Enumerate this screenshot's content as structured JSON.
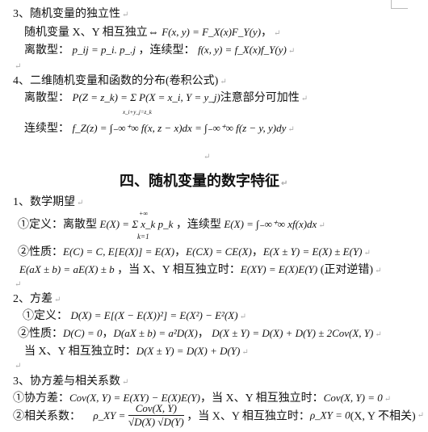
{
  "sec3": {
    "heading": "3、随机变量的独立性",
    "line1_text": "随机变量 X、Y 相互独立⇔",
    "line1_formula": "F(x, y) = F_X(x)F_Y(y)",
    "line1_tail": "，",
    "line2_label1": "离散型：",
    "line2_formula1": "p_ij = p_i. p_.j",
    "line2_label2": "，连续型：",
    "line2_formula2": "f(x, y) = f_X(x)f_Y(y)"
  },
  "sec4": {
    "heading": "4、二维随机变量和函数的分布(卷积公式)",
    "discrete_label": "离散型：",
    "discrete_formula": "P(Z = z_k) = Σ P(X = x_i, Y = y_j)",
    "discrete_sum_index": "x_i+y_j=z_k",
    "discrete_note": "注意部分可加性",
    "continuous_label": "连续型：",
    "continuous_formula": "f_Z(z) = ∫₋∞⁺∞ f(x, z − x)dx = ∫₋∞⁺∞ f(z − y, y)dy"
  },
  "chapter_title": "四、随机变量的数字特征",
  "expectation": {
    "heading": "1、数学期望",
    "def_label": "①定义：离散型",
    "def_formula1": "E(X) = Σ x_k p_k",
    "def_sum_top": "+∞",
    "def_sum_bottom": "k=1",
    "def_label2": "，连续型",
    "def_formula2": "E(X) = ∫₋∞⁺∞ xf(x)dx",
    "prop_label": "②性质：",
    "prop_formula1": "E(C) = C, E[E(X)] = E(X)",
    "prop_sep1": "，",
    "prop_formula2": "E(CX) = CE(X)",
    "prop_sep2": "，",
    "prop_formula3": "E(X ± Y) = E(X) ± E(Y)",
    "prop2_formula1": "E(aX ± b) = aE(X) ± b",
    "prop2_text": "，当 X、Y 相互独立时：",
    "prop2_formula2": "E(XY) = E(X)E(Y)",
    "prop2_note": "(正对逆错)"
  },
  "variance": {
    "heading": "2、方差",
    "def_label": "①定义：",
    "def_formula": "D(X) = E[(X − E(X))²] = E(X²) − E²(X)",
    "prop_label": "②性质：",
    "prop_formula1": "D(C) = 0",
    "prop_sep": "，",
    "prop_formula2": "D(aX ± b) = a²D(X)",
    "prop_sep2": "，",
    "prop_formula3": "D(X ± Y) = D(X) + D(Y) ± 2Cov(X, Y)",
    "indep_text": "当 X、Y 相互独立时：",
    "indep_formula": "D(X ± Y) = D(X) + D(Y)"
  },
  "covariance": {
    "heading": "3、协方差与相关系数",
    "cov_label": "①协方差：",
    "cov_formula": "Cov(X, Y) = E(XY) − E(X)E(Y)",
    "cov_text": "，当 X、Y 相互独立时：",
    "cov_formula2": "Cov(X, Y) = 0",
    "corr_label": "②相关系数：",
    "corr_lhs": "ρ_XY =",
    "corr_num": "Cov(X, Y)",
    "corr_den": "√D(X) √D(Y)",
    "corr_text": "，当 X、Y 相互独立时：",
    "corr_formula2": "ρ_XY = 0",
    "corr_note": "(X, Y 不相关)"
  }
}
